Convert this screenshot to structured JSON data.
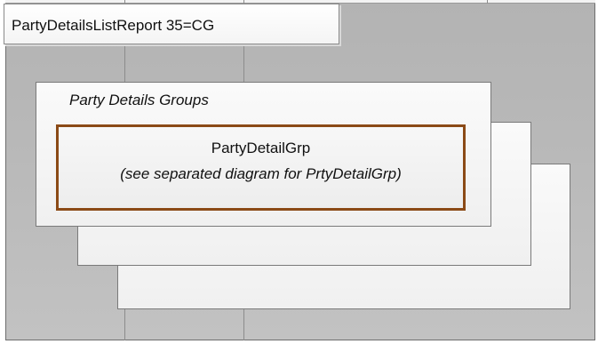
{
  "diagram": {
    "title": "PartyDetailsListReport 35=CG",
    "group_heading": "Party Details Groups",
    "component": {
      "name": "PartyDetailGrp",
      "note": "(see separated diagram for PrtyDetailGrp)"
    },
    "colors": {
      "background_gray": "#b8b8b8",
      "card_fill": "#f2f2f2",
      "component_border": "#8b4a16",
      "frame_line": "#6e6e6e"
    }
  }
}
